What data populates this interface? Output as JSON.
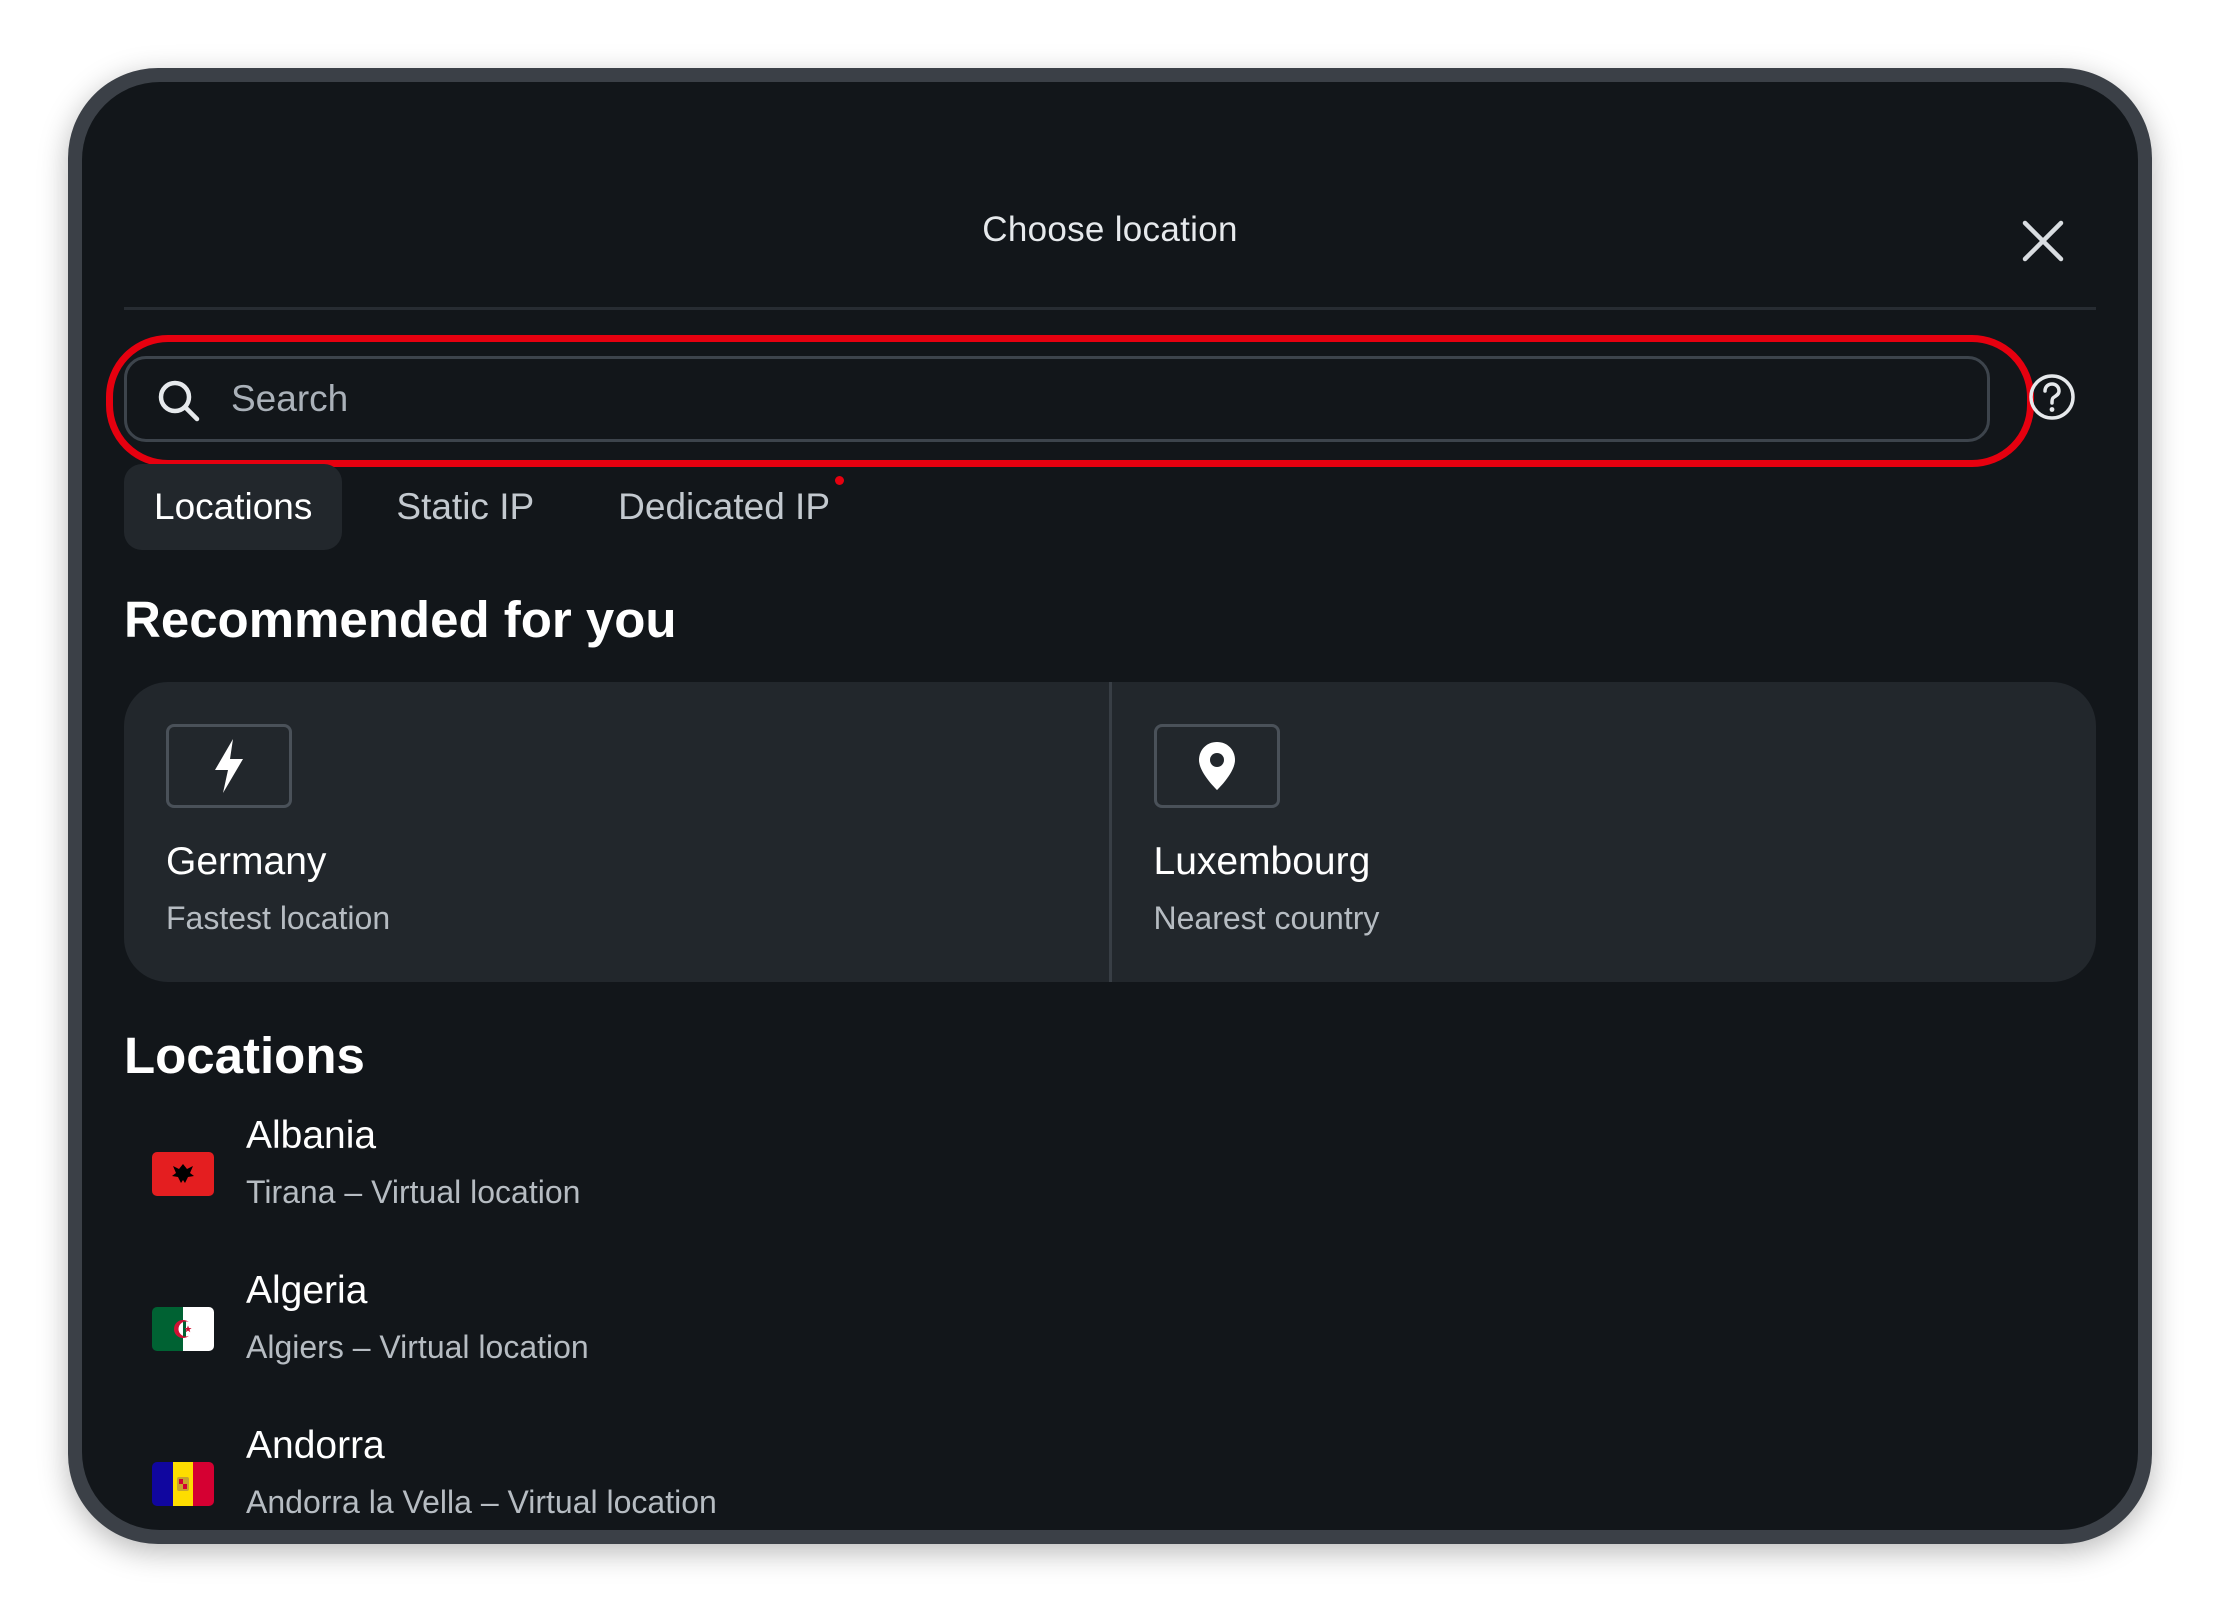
{
  "header": {
    "title": "Choose location",
    "close_icon": "close-icon",
    "help_icon": "help-icon"
  },
  "search": {
    "placeholder": "Search",
    "value": "",
    "icon": "search-icon"
  },
  "tabs": [
    {
      "label": "Locations",
      "active": true
    },
    {
      "label": "Static IP",
      "active": false
    },
    {
      "label": "Dedicated IP",
      "active": false,
      "has_dot": true
    }
  ],
  "recommended": {
    "title": "Recommended for you",
    "cards": [
      {
        "icon": "lightning-icon",
        "name": "Germany",
        "subtitle": "Fastest location"
      },
      {
        "icon": "location-pin-icon",
        "name": "Luxembourg",
        "subtitle": "Nearest country"
      }
    ]
  },
  "locations": {
    "title": "Locations",
    "items": [
      {
        "flag": "albania-flag-icon",
        "name": "Albania",
        "subtitle": "Tirana – Virtual location"
      },
      {
        "flag": "algeria-flag-icon",
        "name": "Algeria",
        "subtitle": "Algiers – Virtual location"
      },
      {
        "flag": "andorra-flag-icon",
        "name": "Andorra",
        "subtitle": "Andorra la Vella – Virtual location"
      }
    ]
  },
  "colors": {
    "background": "#12161a",
    "card": "#22272c",
    "highlight": "#e6000f",
    "text_primary": "#ffffff",
    "text_secondary": "#b6bcc2"
  }
}
